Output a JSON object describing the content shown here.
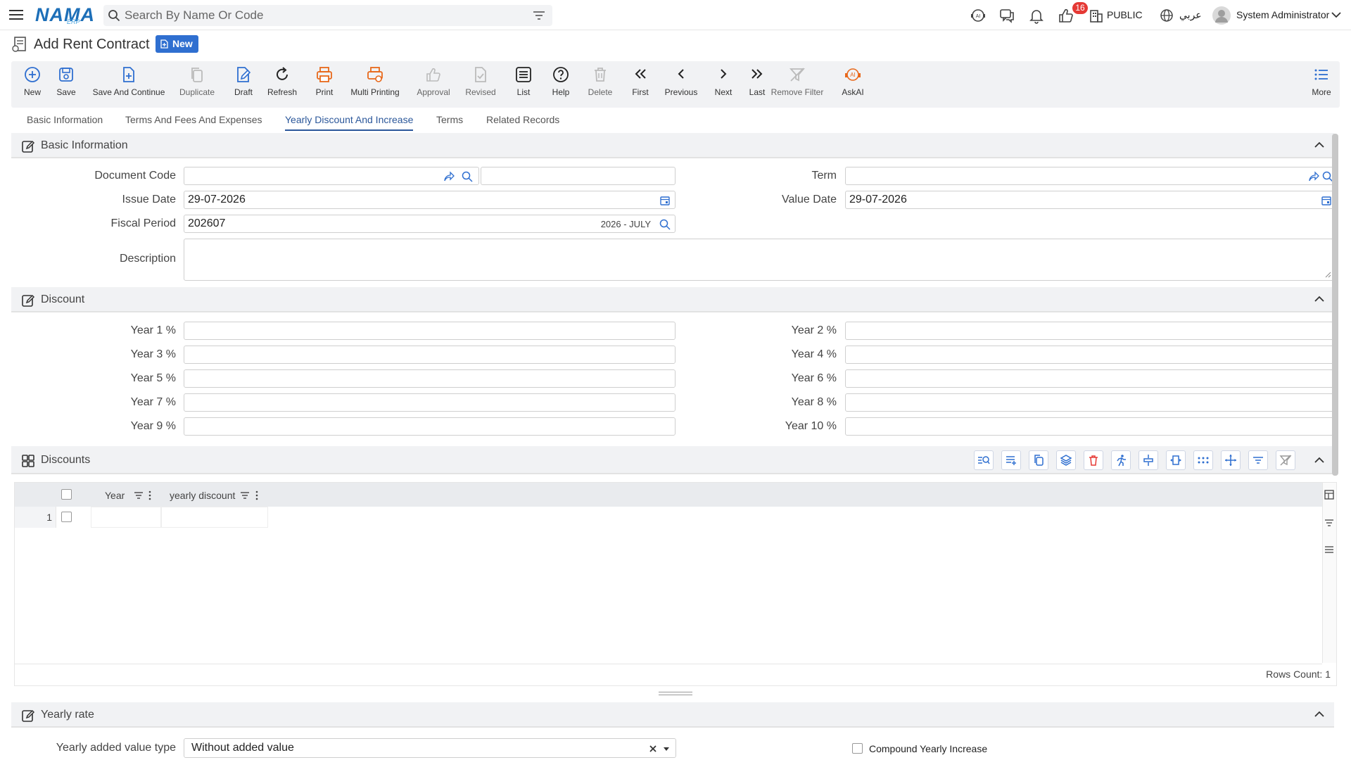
{
  "header": {
    "logo_text": "NAMA",
    "logo_sub": "ERP",
    "search_placeholder": "Search By Name Or Code",
    "notifications_count": "16",
    "public_label": "PUBLIC",
    "language_label": "عربي",
    "user_name": "System Administrator"
  },
  "page": {
    "title": "Add Rent Contract",
    "status_badge": "New"
  },
  "toolbar": {
    "new": "New",
    "save": "Save",
    "save_continue": "Save And Continue",
    "duplicate": "Duplicate",
    "draft": "Draft",
    "refresh": "Refresh",
    "print": "Print",
    "multi_printing": "Multi Printing",
    "approval": "Approval",
    "revised": "Revised",
    "list": "List",
    "help": "Help",
    "delete": "Delete",
    "first": "First",
    "previous": "Previous",
    "next": "Next",
    "last": "Last",
    "remove_filter": "Remove Filter",
    "askai": "AskAI",
    "more": "More"
  },
  "tabs": [
    "Basic Information",
    "Terms And Fees And Expenses",
    "Yearly Discount And Increase",
    "Terms",
    "Related Records"
  ],
  "basic": {
    "title": "Basic Information",
    "document_code_label": "Document Code",
    "term_label": "Term",
    "issue_date_label": "Issue Date",
    "issue_date_value": "29-07-2026",
    "value_date_label": "Value Date",
    "value_date_value": "29-07-2026",
    "fiscal_period_label": "Fiscal Period",
    "fiscal_period_value": "202607",
    "fiscal_period_tag": "2026 - JULY",
    "description_label": "Description"
  },
  "discount": {
    "title": "Discount",
    "labels": [
      "Year 1 %",
      "Year 2 %",
      "Year 3 %",
      "Year 4 %",
      "Year 5 %",
      "Year 6 %",
      "Year 7 %",
      "Year 8 %",
      "Year 9 %",
      "Year 10 %"
    ]
  },
  "discounts_grid": {
    "title": "Discounts",
    "columns": [
      "Year",
      "yearly discount"
    ],
    "row_number": "1",
    "rows_count": "Rows Count: 1"
  },
  "yearly_rate": {
    "title": "Yearly rate",
    "added_value_type_label": "Yearly added value type",
    "added_value_type_value": "Without added value",
    "compound_label": "Compound Yearly Increase"
  },
  "colors": {
    "brand": "#1d6fb8",
    "accent_blue": "#2f6fd0",
    "print_orange": "#e8681a",
    "danger": "#e53935"
  }
}
